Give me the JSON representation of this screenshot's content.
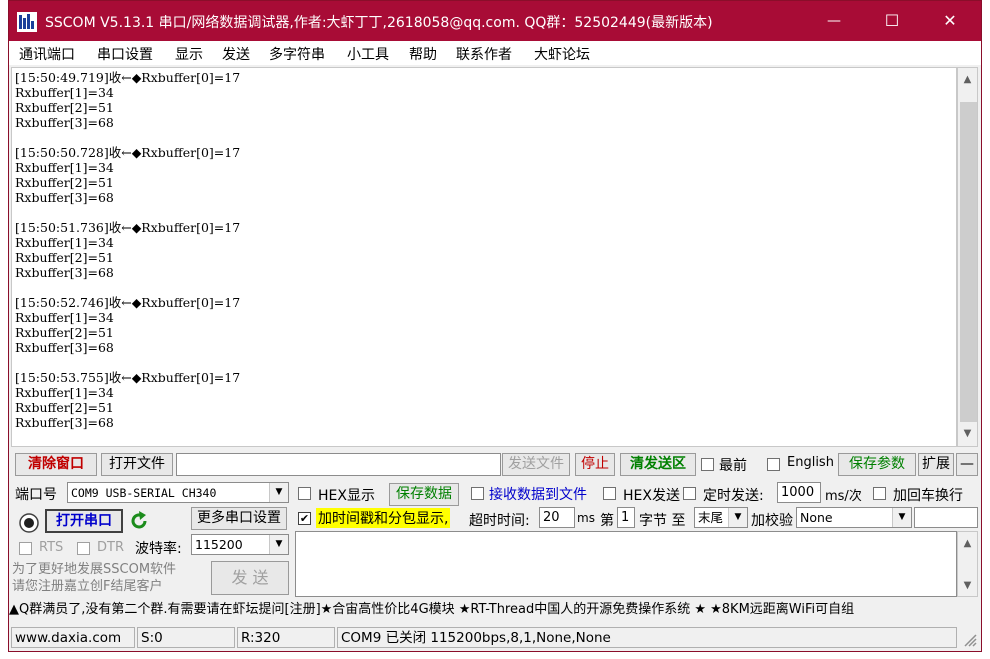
{
  "window": {
    "title": "SSCOM V5.13.1 串口/网络数据调试器,作者:大虾丁丁,2618058@qq.com. QQ群：52502449(最新版本)",
    "minimize_glyph": "—",
    "maximize_glyph": "☐",
    "close_glyph": "✕"
  },
  "menu": [
    "通讯端口",
    "串口设置",
    "显示",
    "发送",
    "多字符串",
    "小工具",
    "帮助",
    "联系作者",
    "大虾论坛"
  ],
  "receive_lines": [
    "[15:50:49.719]收←◆Rxbuffer[0]=17",
    "Rxbuffer[1]=34",
    "Rxbuffer[2]=51",
    "Rxbuffer[3]=68",
    "",
    "[15:50:50.728]收←◆Rxbuffer[0]=17",
    "Rxbuffer[1]=34",
    "Rxbuffer[2]=51",
    "Rxbuffer[3]=68",
    "",
    "[15:50:51.736]收←◆Rxbuffer[0]=17",
    "Rxbuffer[1]=34",
    "Rxbuffer[2]=51",
    "Rxbuffer[3]=68",
    "",
    "[15:50:52.746]收←◆Rxbuffer[0]=17",
    "Rxbuffer[1]=34",
    "Rxbuffer[2]=51",
    "Rxbuffer[3]=68",
    "",
    "[15:50:53.755]收←◆Rxbuffer[0]=17",
    "Rxbuffer[1]=34",
    "Rxbuffer[2]=51",
    "Rxbuffer[3]=68"
  ],
  "toolbar": {
    "clear_window": "清除窗口",
    "open_file": "打开文件",
    "file_path": "",
    "send_file": "发送文件",
    "stop": "停止",
    "clear_send": "清发送区",
    "topmost": "最前",
    "english": "English",
    "save_params": "保存参数",
    "expand": "扩展",
    "collapse": "—"
  },
  "port": {
    "port_label": "端口号",
    "port_value": "COM9 USB-SERIAL CH340",
    "hex_display": "HEX显示",
    "save_data": "保存数据",
    "recv_to_file": "接收数据到文件",
    "hex_send": "HEX发送",
    "timed_send": "定时发送:",
    "interval": "1000",
    "interval_unit": "ms/次",
    "append_crlf": "加回车换行",
    "open_port": "打开串口",
    "more_settings": "更多串口设置",
    "timestamp": "加时间戳和分包显示,",
    "timeout_label": "超时时间:",
    "timeout": "20",
    "timeout_unit": "ms",
    "byte_nth": "第",
    "byte_index": "1",
    "byte_to": "字节 至",
    "byte_end": "末尾",
    "checksum_label": "加校验",
    "checksum": "None",
    "rts": "RTS",
    "dtr": "DTR",
    "baud_label": "波特率:",
    "baud": "115200",
    "send_text": "",
    "promo": "为了更好地发展SSCOM软件\n请您注册嘉立创F结尾客户",
    "send": "发 送"
  },
  "ticker": "▲Q群满员了,没有第二个群.有需要请在虾坛提问[注册]★合宙高性价比4G模块 ★RT-Thread中国人的开源免费操作系统 ★ ★8KM远距离WiFi可自组",
  "status": {
    "site": "www.daxia.com",
    "sent": "S:0",
    "received": "R:320",
    "port_state": "COM9 已关闭  115200bps,8,1,None,None"
  },
  "colors": {
    "title_bar": "#a80c36",
    "danger_text": "#c00000",
    "accent_green": "#008000",
    "link_blue": "#0000cc",
    "highlight_yellow": "#ffff00"
  }
}
